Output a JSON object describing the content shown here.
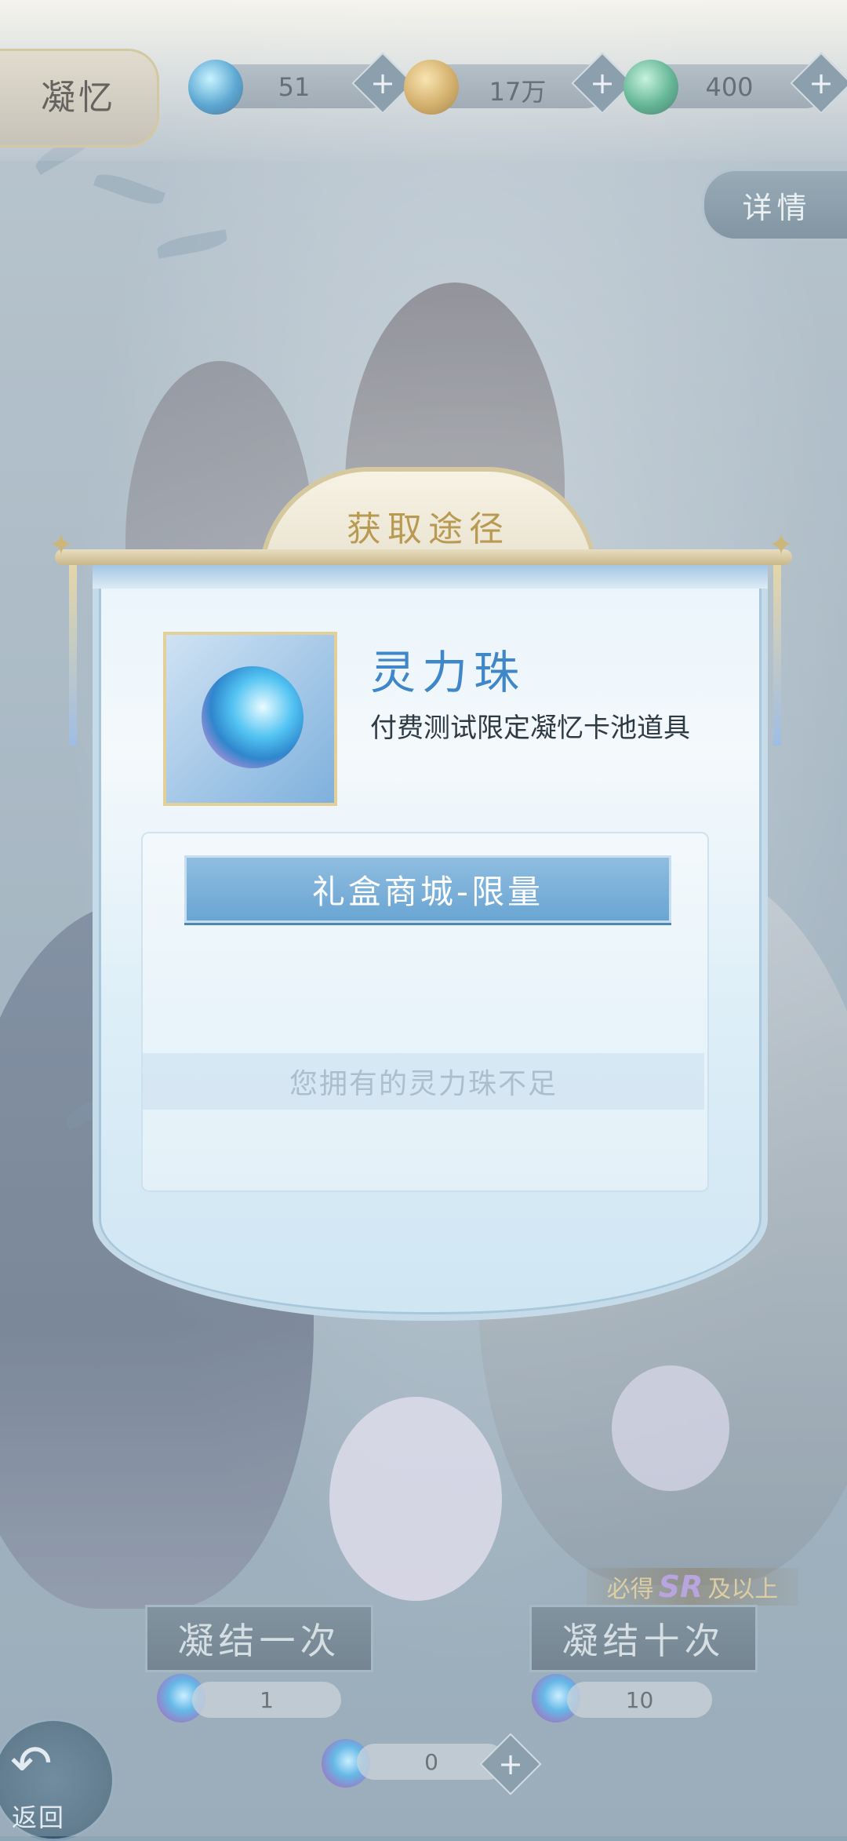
{
  "header": {
    "title": "凝忆",
    "resources": [
      {
        "icon": "spirit-orb-icon",
        "value": "51"
      },
      {
        "icon": "coin-icon",
        "value": "17万"
      },
      {
        "icon": "jade-icon",
        "value": "400"
      }
    ],
    "plus_label": "+",
    "details_label": "详情"
  },
  "modal": {
    "title": "获取途径",
    "item_name": "灵力珠",
    "item_desc": "付费测试限定凝忆卡池道具",
    "source_button": "礼盒商城-限量",
    "toast": "您拥有的灵力珠不足"
  },
  "bottom": {
    "guarantee_prefix": "必得",
    "guarantee_sr": "SR",
    "guarantee_suffix": "及以上",
    "draw_one_label": "凝结一次",
    "draw_one_cost": "1",
    "draw_ten_label": "凝结十次",
    "draw_ten_cost": "10",
    "owned_count": "0",
    "plus_label": "+",
    "back_label": "返回",
    "back_icon": "↶"
  },
  "colors": {
    "accent_blue": "#3f87c9",
    "gold": "#b99a52",
    "button_blue": "#6aa5d3"
  }
}
